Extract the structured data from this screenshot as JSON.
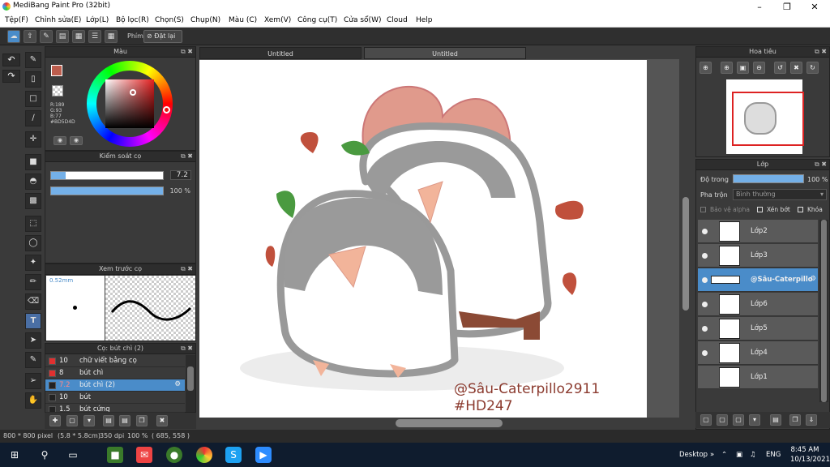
{
  "app_title": "MediBang Paint Pro (32bit)",
  "menu": [
    "Tệp(F)",
    "Chỉnh sửa(E)",
    "Lớp(L)",
    "Bộ lọc(R)",
    "Chọn(S)",
    "Chụp(N)",
    "Màu (C)",
    "Xem(V)",
    "Công cụ(T)",
    "Cửa sổ(W)",
    "Cloud",
    "Help"
  ],
  "toolbar": {
    "key_label": "Phím",
    "reset_label": "Đặt lại"
  },
  "color_panel": {
    "title": "Màu",
    "r": "R:189",
    "g": "G:93",
    "b": "B:77",
    "hex": "#BD5D4D",
    "fg_color": "#BD5D4D"
  },
  "brush_control": {
    "title": "Kiểm soát cọ",
    "size_value": "7.2",
    "opacity_value": "100 %",
    "size_fraction": 0.13,
    "opacity_fraction": 1.0
  },
  "brush_preview": {
    "title": "Xem trước cọ",
    "size": "0.52mm"
  },
  "brush_list": {
    "title": "Cọ: bút chì (2)",
    "items": [
      {
        "size": "10",
        "name": "chữ viết bằng cọ",
        "color": "#e03030"
      },
      {
        "size": "8",
        "name": "bút chì",
        "color": "#e03030"
      },
      {
        "size": "7.2",
        "name": "bút chì (2)",
        "color": "#222222"
      },
      {
        "size": "10",
        "name": "bút",
        "color": "#222222"
      },
      {
        "size": "1.5",
        "name": "bút cứng",
        "color": "#222222"
      }
    ]
  },
  "tabs": [
    "Untitled",
    "Untitled"
  ],
  "canvas_text": {
    "line1": "@Sâu-Caterpillo2911",
    "line2": "#HD247"
  },
  "navigator": {
    "title": "Hoa tiêu"
  },
  "layers_panel": {
    "title": "Lớp",
    "opacity_label": "Độ trong",
    "opacity_value": "100 %",
    "blend_label": "Pha trộn",
    "blend_value": "Bình thường",
    "protect_alpha": "Bảo vệ alpha",
    "clip": "Xén bớt",
    "lock": "Khóa",
    "layers": [
      "Lớp2",
      "Lớp3",
      "@Sâu-Caterpillo",
      "Lớp6",
      "Lớp5",
      "Lớp4",
      "Lớp1"
    ]
  },
  "status": {
    "size": "800 * 800 pixel",
    "cm": "(5.8 * 5.8cm)",
    "dpi": "350 dpi",
    "zoom": "100 %",
    "coords": "( 685, 558 )"
  },
  "taskbar": {
    "desktop": "Desktop",
    "lang": "ENG",
    "time": "8:45 AM",
    "date": "10/13/2021"
  }
}
